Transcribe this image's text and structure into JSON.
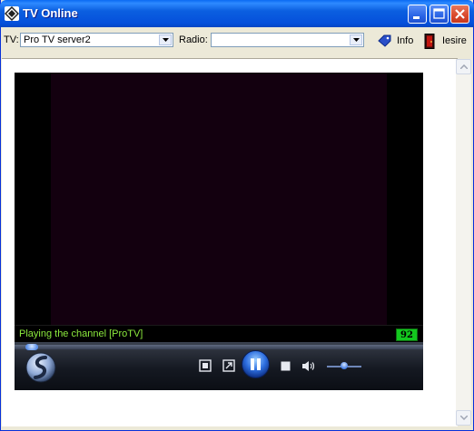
{
  "window": {
    "title": "TV Online"
  },
  "toolbar": {
    "tv_label": "TV:",
    "tv_selected": "Pro TV server2",
    "radio_label": "Radio:",
    "radio_selected": "",
    "info_label": "Info",
    "exit_label": "Iesire"
  },
  "player": {
    "status_text": "Playing the channel [ProTV]",
    "buffer_value": "92"
  },
  "icons": {
    "app": "tv-online-icon",
    "info": "info-tag-icon",
    "exit": "exit-door-icon",
    "logo": "player-logo-icon",
    "controls": [
      "switch-view-icon",
      "fullscreen-icon",
      "pause-icon",
      "stop-icon",
      "volume-icon"
    ]
  },
  "colors": {
    "titlebar": "#0550DB",
    "status_text": "#8BE93D",
    "buffer_bg": "#13C81E",
    "video_bg": "#13000F"
  }
}
